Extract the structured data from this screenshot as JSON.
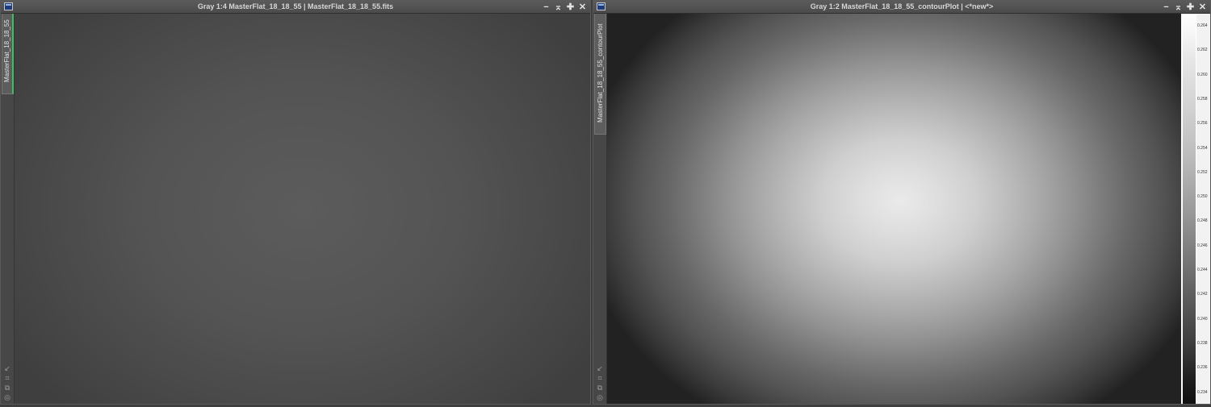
{
  "left_window": {
    "title": "Gray 1:4 MasterFlat_18_18_55 | MasterFlat_18_18_55.fits",
    "tab_label": "MasterFlat_18_18_55"
  },
  "right_window": {
    "title": "Gray 1:2 MasterFlat_18_18_55_contourPlot | <*new*>",
    "tab_label": "MasterFlat_18_18_55_contourPlot"
  },
  "window_controls": {
    "minimize": "−",
    "shade": "⌅",
    "maximize": "✚",
    "close": "✕"
  },
  "side_icons": [
    "↙",
    "⌗",
    "⧉",
    "◎"
  ],
  "colorbar": {
    "ticks": [
      "0.264",
      "0.262",
      "0.260",
      "0.258",
      "0.256",
      "0.254",
      "0.252",
      "0.250",
      "0.248",
      "0.246",
      "0.244",
      "0.242",
      "0.240",
      "0.238",
      "0.236",
      "0.234"
    ]
  }
}
